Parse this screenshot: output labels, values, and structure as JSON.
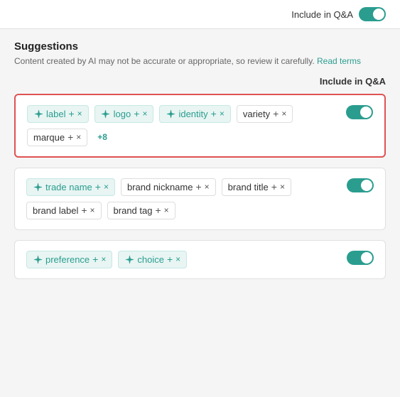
{
  "topBar": {
    "toggleLabel": "Include in Q&A",
    "toggleOn": true
  },
  "suggestions": {
    "title": "Suggestions",
    "description": "Content created by AI may not be accurate or appropriate, so review it carefully.",
    "readTermsLabel": "Read terms",
    "columnHeader": "Include in Q&A"
  },
  "cards": [
    {
      "id": "card1",
      "highlighted": true,
      "toggleOn": true,
      "tags": [
        {
          "type": "ai",
          "text": "label"
        },
        {
          "type": "ai",
          "text": "logo"
        },
        {
          "type": "ai",
          "text": "identity"
        },
        {
          "type": "plain",
          "text": "variety"
        },
        {
          "type": "plain",
          "text": "marque"
        },
        {
          "type": "more",
          "text": "+8"
        }
      ]
    },
    {
      "id": "card2",
      "highlighted": false,
      "toggleOn": true,
      "tags": [
        {
          "type": "ai",
          "text": "trade name"
        },
        {
          "type": "plain",
          "text": "brand nickname"
        },
        {
          "type": "plain",
          "text": "brand title"
        },
        {
          "type": "plain",
          "text": "brand label"
        },
        {
          "type": "plain",
          "text": "brand tag"
        }
      ]
    },
    {
      "id": "card3",
      "highlighted": false,
      "toggleOn": true,
      "tags": [
        {
          "type": "ai",
          "text": "preference"
        },
        {
          "type": "ai",
          "text": "choice"
        }
      ]
    }
  ],
  "icons": {
    "sparkle": "✦",
    "plus": "+",
    "close": "×"
  }
}
